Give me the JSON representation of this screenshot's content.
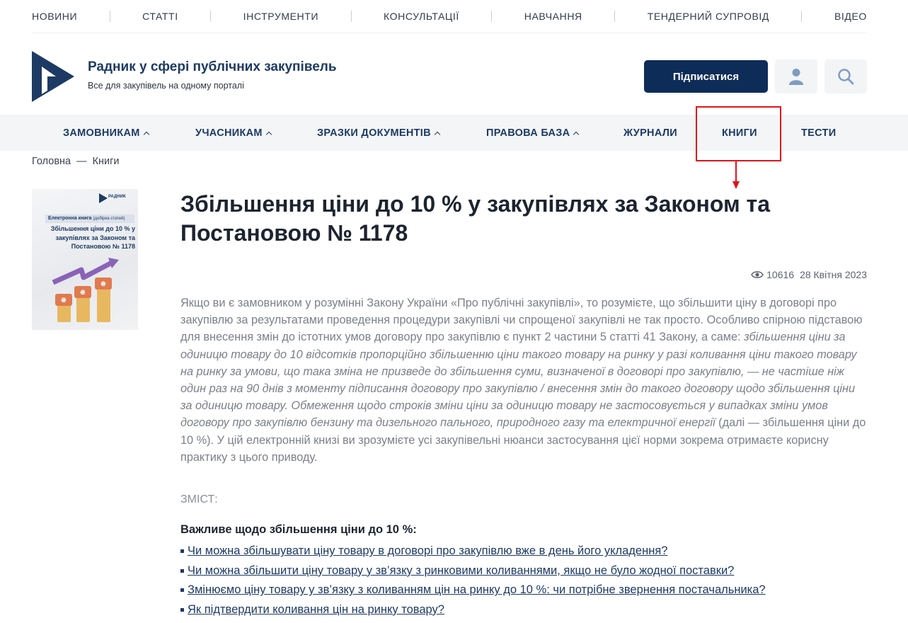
{
  "top_nav": [
    "НОВИНИ",
    "СТАТТІ",
    "ІНСТРУМЕНТИ",
    "КОНСУЛЬТАЦІЇ",
    "НАВЧАННЯ",
    "ТЕНДЕРНИЙ СУПРОВІД",
    "ВІДЕО"
  ],
  "brand": {
    "title": "Радник у сфері публічних закупівель",
    "subtitle": "Все для закупівель на одному порталі"
  },
  "header": {
    "subscribe_label": "Підписатися",
    "user_icon": "user-icon",
    "search_icon": "search-icon"
  },
  "main_nav": [
    {
      "label": "ЗАМОВНИКАМ",
      "has_chevron": true
    },
    {
      "label": "УЧАСНИКАМ",
      "has_chevron": true
    },
    {
      "label": "ЗРАЗКИ ДОКУМЕНТІВ",
      "has_chevron": true
    },
    {
      "label": "ПРАВОВА БАЗА",
      "has_chevron": true
    },
    {
      "label": "ЖУРНАЛИ",
      "has_chevron": false
    },
    {
      "label": "КНИГИ",
      "has_chevron": false
    },
    {
      "label": "ТЕСТИ",
      "has_chevron": false
    }
  ],
  "annotation_color": "#e3131b",
  "breadcrumb": {
    "home": "Головна",
    "separator": "—",
    "current": "Книги"
  },
  "cover": {
    "top_brand": "РАДНИК",
    "badge_bold": "Електронна книга",
    "badge_small": "(добірка статей)",
    "title": "Збільшення ціни до 10 % у закупівлях за Законом та Постановою № 1178"
  },
  "article": {
    "title": "Збільшення ціни до 10 % у закупівлях за Законом та Постановою № 1178",
    "views": "10616",
    "date": "28 Квітня 2023",
    "intro": "Якщо ви є замовником у розумінні Закону України «Про публічні закупівлі», то розумієте, що збільшити ціну в договорі про закупівлю за результатами проведення процедури закупівлі чи спрощеної закупівлі не так просто. Особливо спірною підставою для внесення змін до істотних умов договору про закупівлю є пункт 2 частини 5 статті 41 Закону, а саме: ",
    "quote": "збільшення ціни за одиницю товару до 10 відсотків пропорційно збільшенню ціни такого товару на ринку у разі коливання ціни такого товару на ринку за умови, що така зміна не призведе до збільшення суми, визначеної в договорі про закупівлю, — не частіше ніж один раз на 90 днів з моменту підписання договору про закупівлю / внесення змін до такого договору щодо збільшення ціни за одиницю товару. Обмеження щодо строків зміни ціни за одиницю товару не застосовується у випадках зміни умов договору про закупівлю бензину та дизельного пального, природного газу та електричної енергії",
    "outro": " (далі — збільшення ціни до 10 %). У цій електронній книзі ви зрозумієте усі закупівельні нюанси застосування цієї норми зокрема отримаєте корисну практику з цього приводу.",
    "contents_label": "ЗМІСТ:",
    "section_title": "Важливе щодо збільшення ціни до 10 %:",
    "links": [
      "Чи можна збільшувати ціну товару в договорі про закупівлю вже в день його укладення?",
      "Чи можна збільшити ціну товару у зв’язку з ринковими коливаннями, якщо не було жодної поставки?",
      "Змінюємо ціну товару у зв’язку з коливанням цін на ринку до 10 %: чи потрібне звернення постачальника?",
      "Як підтвердити коливання цін на ринку товару?"
    ]
  }
}
